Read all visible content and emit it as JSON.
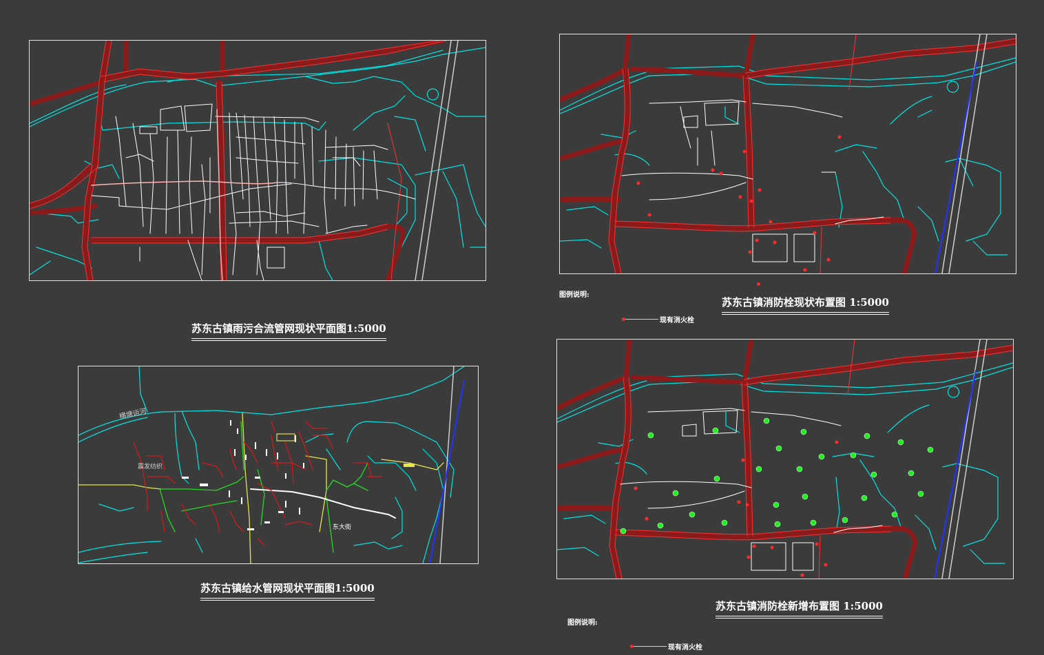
{
  "titles": {
    "combined_sewer": "苏东古镇雨污合流管网现状平面图1:5000",
    "hydrant_existing": "苏东古镇消防栓现状布置图 1:5000",
    "water_supply": "苏东古镇给水管网现状平面图1:5000",
    "hydrant_new": "苏东古镇消防栓新增布置图 1:5000"
  },
  "legend_top": {
    "heading": "图例说明:",
    "item": "现有消火栓"
  },
  "legend_bottom": {
    "heading": "图例说明:",
    "item": "现有消火栓"
  },
  "map_labels": {
    "canal": "横塘运河",
    "factory": "震发纺织",
    "street": "东大街"
  },
  "colors": {
    "background": "#3b3b3b",
    "frame": "#e6e6e6",
    "road_edge": "#ff3030",
    "road_casing": "#8b1a1a",
    "river": "#00e5e5",
    "pipe": "#ffffff",
    "highway": "#2233ff",
    "hydrant_existing": "#ff2a2a",
    "hydrant_new": "#22ee22",
    "water_main_green": "#22dd22",
    "water_main_yellow": "#e6e64a"
  }
}
